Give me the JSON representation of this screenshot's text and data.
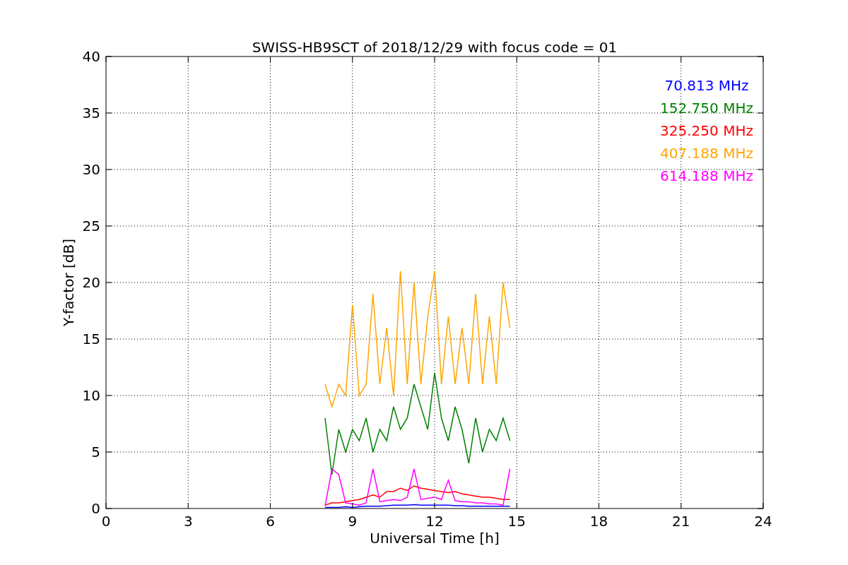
{
  "figure": {
    "chart_data": {
      "type": "line",
      "title": "SWISS-HB9SCT of 2018/12/29 with focus code = 01",
      "xlabel": "Universal Time [h]",
      "ylabel": "Y-factor [dB]",
      "x": [
        8.0,
        8.25,
        8.5,
        8.75,
        9.0,
        9.25,
        9.5,
        9.75,
        10.0,
        10.25,
        10.5,
        10.75,
        11.0,
        11.25,
        11.5,
        11.75,
        12.0,
        12.25,
        12.5,
        12.75,
        13.0,
        13.25,
        13.5,
        13.75,
        14.0,
        14.25,
        14.5,
        14.75
      ],
      "grid": true,
      "xlim": [
        0,
        24
      ],
      "ylim": [
        0,
        40
      ],
      "xticks": [
        0,
        3,
        6,
        9,
        12,
        15,
        18,
        21,
        24
      ],
      "yticks": [
        0,
        5,
        10,
        15,
        20,
        25,
        30,
        35,
        40
      ],
      "series": [
        {
          "name": "70.813 MHz",
          "color": "#0000ff",
          "values": [
            0.1,
            0.1,
            0.1,
            0.15,
            0.1,
            0.15,
            0.2,
            0.2,
            0.2,
            0.25,
            0.3,
            0.3,
            0.3,
            0.35,
            0.3,
            0.3,
            0.3,
            0.3,
            0.3,
            0.25,
            0.25,
            0.2,
            0.2,
            0.2,
            0.2,
            0.2,
            0.2,
            0.2
          ]
        },
        {
          "name": "152.750 MHz",
          "color": "#008000",
          "values": [
            8,
            3,
            7,
            5,
            7,
            6,
            8,
            5,
            7,
            6,
            9,
            7,
            8,
            11,
            9,
            7,
            12,
            8,
            6,
            9,
            7,
            4,
            8,
            5,
            7,
            6,
            8,
            6
          ]
        },
        {
          "name": "325.250 MHz",
          "color": "#ff0000",
          "values": [
            0.3,
            0.5,
            0.5,
            0.6,
            0.7,
            0.8,
            1,
            1.2,
            1,
            1.5,
            1.5,
            1.8,
            1.6,
            2,
            1.8,
            1.7,
            1.6,
            1.5,
            1.4,
            1.5,
            1.3,
            1.2,
            1.1,
            1,
            1,
            0.9,
            0.8,
            0.8
          ]
        },
        {
          "name": "407.188 MHz",
          "color": "#ffa500",
          "values": [
            11,
            9,
            11,
            10,
            18,
            10,
            11,
            19,
            11,
            16,
            10,
            21,
            11,
            20,
            11,
            17,
            21,
            11,
            17,
            11,
            16,
            11,
            19,
            11,
            17,
            11,
            20,
            16
          ]
        },
        {
          "name": "614.188 MHz",
          "color": "#ff00ff",
          "values": [
            0.2,
            3.5,
            3,
            0.5,
            0.4,
            0.3,
            0.5,
            3.5,
            0.6,
            0.7,
            0.8,
            0.7,
            1,
            3.5,
            0.8,
            0.9,
            1,
            0.8,
            2.5,
            0.7,
            0.6,
            0.6,
            0.5,
            0.5,
            0.4,
            0.4,
            0.3,
            3.5
          ]
        }
      ]
    }
  }
}
